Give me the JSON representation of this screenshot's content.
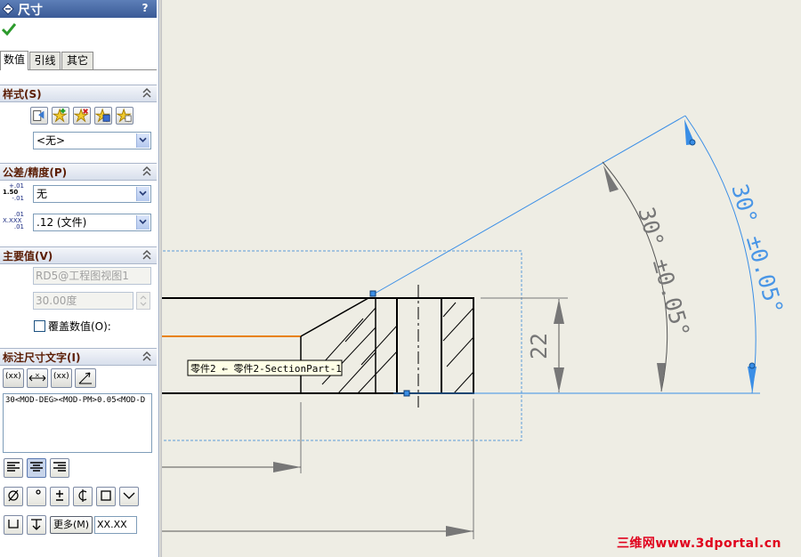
{
  "panel": {
    "title": "尺寸",
    "help": "?",
    "tabs": [
      "数值",
      "引线",
      "其它"
    ],
    "sections": {
      "style": {
        "title": "样式(S)",
        "select_value": "<无>"
      },
      "tolerance": {
        "title": "公差/精度(P)",
        "tol_icon_text": {
          "top": "+.01",
          "mid": "1.50",
          "bot": "-.01"
        },
        "prec_icon_text": {
          "top": ".01",
          "mid": "X.XXX",
          "bot": ".01"
        },
        "tolerance_value": "无",
        "precision_value": ".12 (文件)"
      },
      "primary": {
        "title": "主要值(V)",
        "reference": "RD5@工程图视图1",
        "value": "30.00度",
        "override_label": "覆盖数值(O):"
      },
      "dimtext": {
        "title": "标注尺寸文字(I)",
        "text": "30<MOD-DEG><MOD-PM>0.05<MOD-D",
        "xx_label": "(xx)",
        "more_label": "更多(M)",
        "xx_field": "XX.XX"
      }
    }
  },
  "drawing": {
    "angle_dim_black": "30° ±0.05°",
    "angle_dim_blue": "30° ±0.05°",
    "linear_dim": "22",
    "tooltip": "零件2 ← 零件2-SectionPart-1"
  },
  "colors": {
    "accent_blue": "#3a8ee6",
    "highlight_orange": "#e8820c",
    "watermark_red": "#e0001c"
  },
  "watermark": "三维网www.3dportal.cn"
}
